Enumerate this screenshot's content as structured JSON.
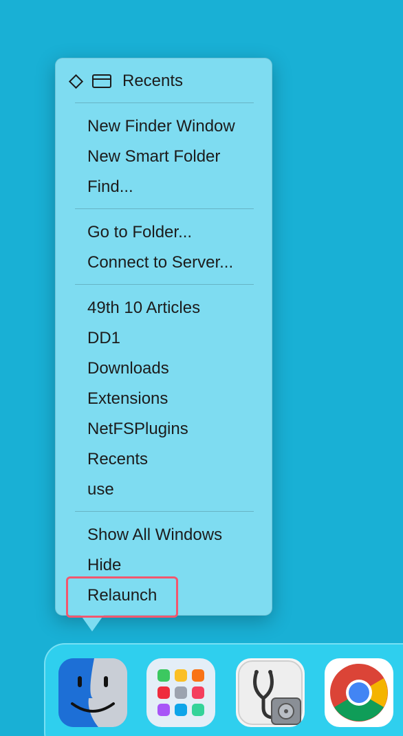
{
  "menu": {
    "header_label": "Recents",
    "groups": [
      [
        "New Finder Window",
        "New Smart Folder",
        "Find..."
      ],
      [
        "Go to Folder...",
        "Connect to Server..."
      ],
      [
        "49th 10 Articles",
        "DD1",
        "Downloads",
        "Extensions",
        "NetFSPlugins",
        "Recents",
        "use"
      ],
      [
        "Show All Windows",
        "Hide",
        "Relaunch"
      ]
    ],
    "highlighted_item": "Relaunch"
  },
  "dock": {
    "apps": [
      "finder-icon",
      "launchpad-icon",
      "disk-utility-icon",
      "chrome-icon"
    ]
  },
  "colors": {
    "desktop": "#19b0d5",
    "menu_bg": "#7edcf1",
    "highlight": "#f2576f",
    "dock_bg": "#2fcfee"
  }
}
